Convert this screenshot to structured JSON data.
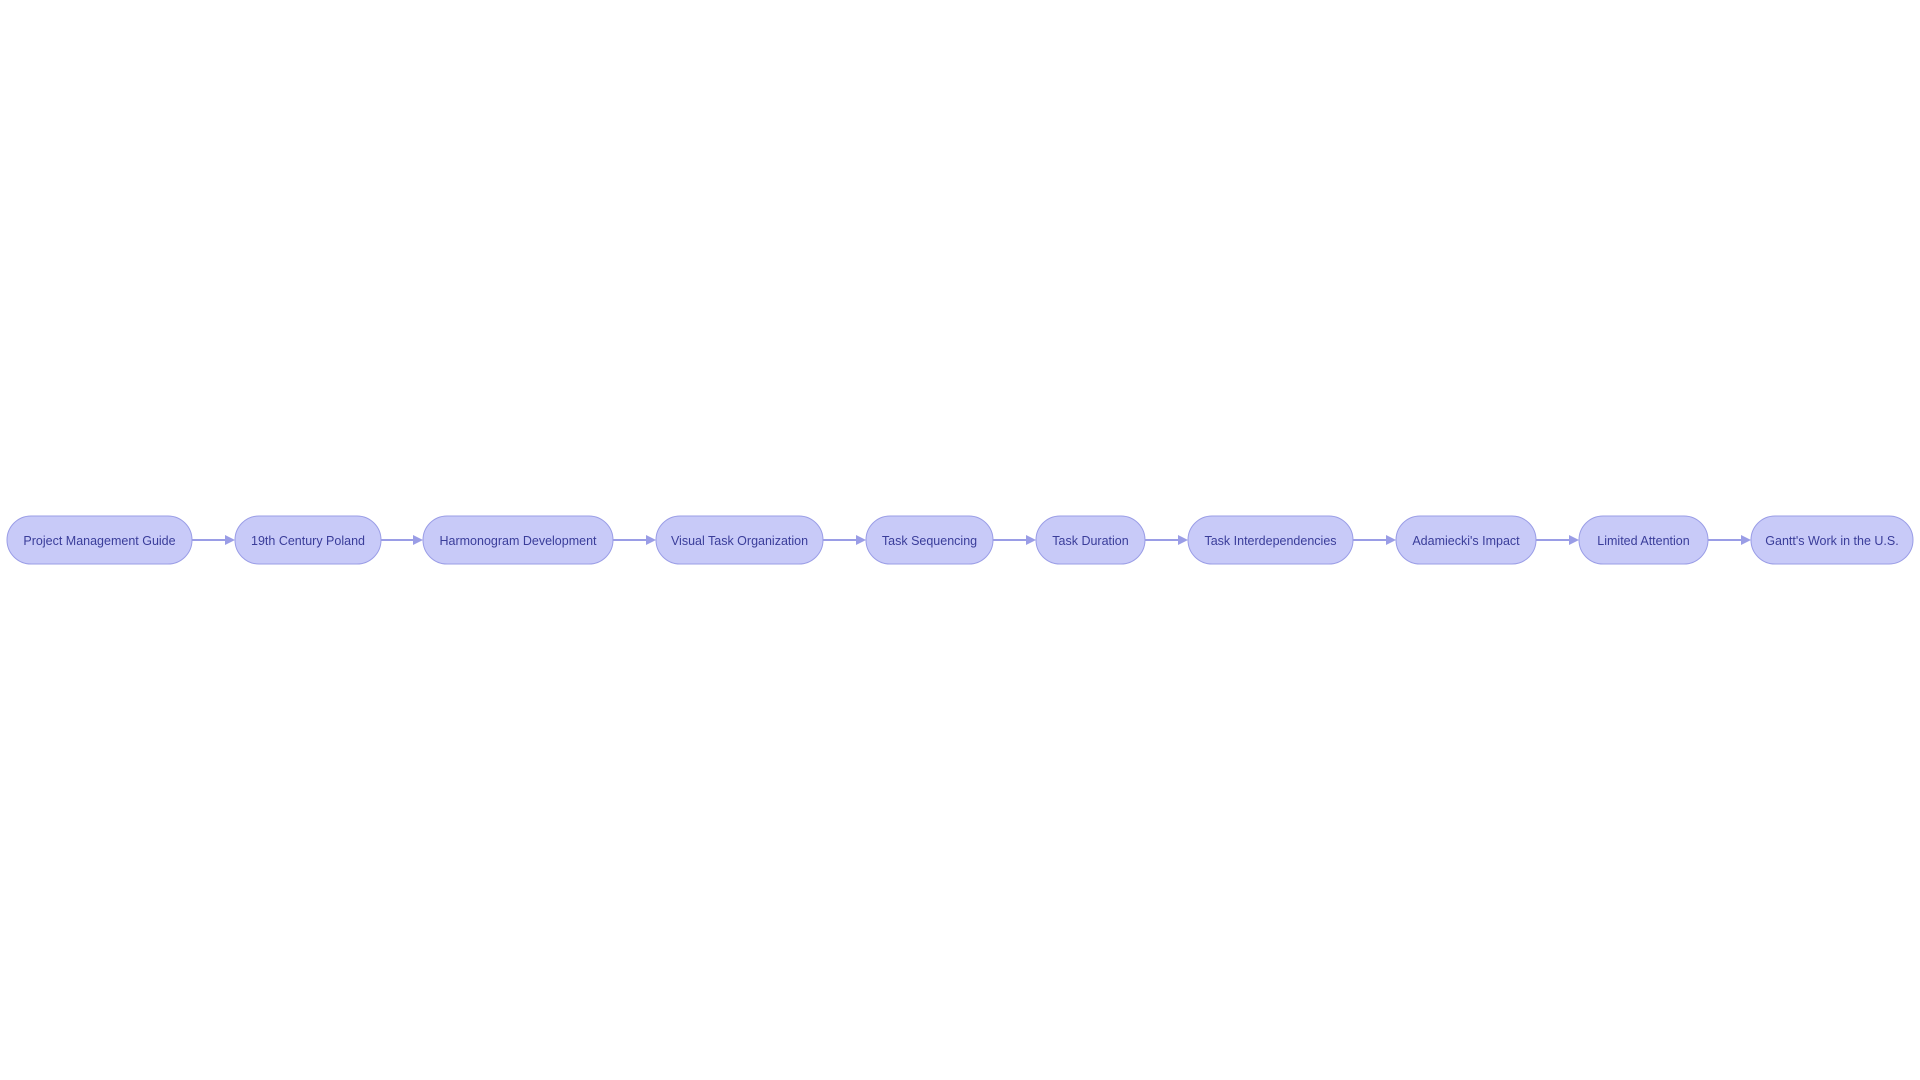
{
  "diagram": {
    "type": "flowchart",
    "direction": "left-to-right",
    "colors": {
      "node_fill": "#c8caf8",
      "node_stroke": "#9a9de6",
      "text": "#3a3d9a",
      "edge": "#9a9de6",
      "background": "#ffffff"
    },
    "nodes": [
      {
        "id": "n1",
        "label": "Project Management Guide"
      },
      {
        "id": "n2",
        "label": "19th Century Poland"
      },
      {
        "id": "n3",
        "label": "Harmonogram Development"
      },
      {
        "id": "n4",
        "label": "Visual Task Organization"
      },
      {
        "id": "n5",
        "label": "Task Sequencing"
      },
      {
        "id": "n6",
        "label": "Task Duration"
      },
      {
        "id": "n7",
        "label": "Task Interdependencies"
      },
      {
        "id": "n8",
        "label": "Adamiecki's Impact"
      },
      {
        "id": "n9",
        "label": "Limited Attention"
      },
      {
        "id": "n10",
        "label": "Gantt's Work in the U.S."
      }
    ],
    "edges": [
      {
        "from": "n1",
        "to": "n2"
      },
      {
        "from": "n2",
        "to": "n3"
      },
      {
        "from": "n3",
        "to": "n4"
      },
      {
        "from": "n4",
        "to": "n5"
      },
      {
        "from": "n5",
        "to": "n6"
      },
      {
        "from": "n6",
        "to": "n7"
      },
      {
        "from": "n7",
        "to": "n8"
      },
      {
        "from": "n8",
        "to": "n9"
      },
      {
        "from": "n9",
        "to": "n10"
      }
    ]
  }
}
